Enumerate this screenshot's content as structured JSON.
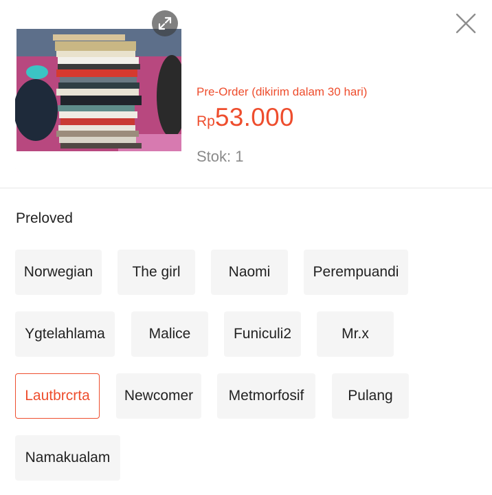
{
  "product": {
    "preorder_text": "Pre-Order (dikirim dalam 30 hari)",
    "currency": "Rp",
    "price": "53.000",
    "stock_text": "Stok: 1"
  },
  "variation": {
    "title": "Preloved",
    "options": [
      "Norwegian",
      "The girl",
      "Naomi",
      "Perempuandi",
      "Ygtelahlama",
      "Malice",
      "Funiculi2",
      "Mr.x",
      "Lautbrcrta",
      "Newcomer",
      "Metmorfosif",
      "Pulang",
      "Namakualam"
    ],
    "selected": "Lautbrcrta"
  },
  "icons": {
    "expand": "expand-icon",
    "close": "close-icon"
  },
  "colors": {
    "accent": "#ee4d2d",
    "chip_bg": "#f5f5f5",
    "muted": "#8a8a8a"
  }
}
